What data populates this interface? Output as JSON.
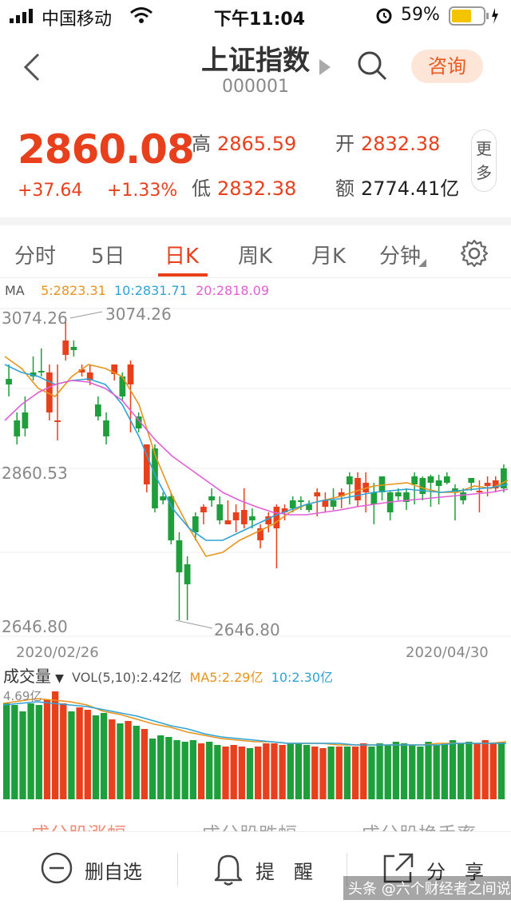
{
  "status": {
    "carrier": "中国移动",
    "time": "下午11:04",
    "battery": "59%"
  },
  "nav": {
    "title": "上证指数",
    "code": "000001",
    "consult": "咨询"
  },
  "quote": {
    "price": "2860.08",
    "change": "+37.64",
    "change_pct": "+1.33%",
    "high_label": "高",
    "high": "2865.59",
    "open_label": "开",
    "open": "2832.38",
    "low_label": "低",
    "low": "2832.38",
    "amount_label": "额",
    "amount": "2774.41亿",
    "more": "更多"
  },
  "tabs": [
    "分时",
    "5日",
    "日K",
    "周K",
    "月K",
    "分钟"
  ],
  "active_tab": "日K",
  "ma": {
    "label": "MA",
    "ma5": "5:2823.31",
    "ma10": "10:2831.71",
    "ma20": "20:2818.09"
  },
  "colors": {
    "up": "#e8401c",
    "down": "#1f9e3c",
    "ma5": "#e8941c",
    "ma10": "#2fa3d6",
    "ma20": "#e05fd6"
  },
  "chart": {
    "y_high": "3074.26",
    "y_mid": "2860.53",
    "y_low": "2646.80",
    "max_marker": "3074.26",
    "min_marker": "2646.80",
    "date_start": "2020/02/26",
    "date_end": "2020/04/30"
  },
  "volume": {
    "title": "成交量",
    "vol": "VOL(5,10):2.42亿",
    "ma5": "MA5:2.29亿",
    "ma10": "10:2.30亿",
    "max_label": "4.69亿"
  },
  "bottom_tabs": [
    "成分股涨幅",
    "成分股跌幅",
    "成分股换手率"
  ],
  "toolbar": {
    "remove": "删自选",
    "alert": "提　醒",
    "share": "分　享"
  },
  "watermark": "头条 @六个财经者之间说"
}
